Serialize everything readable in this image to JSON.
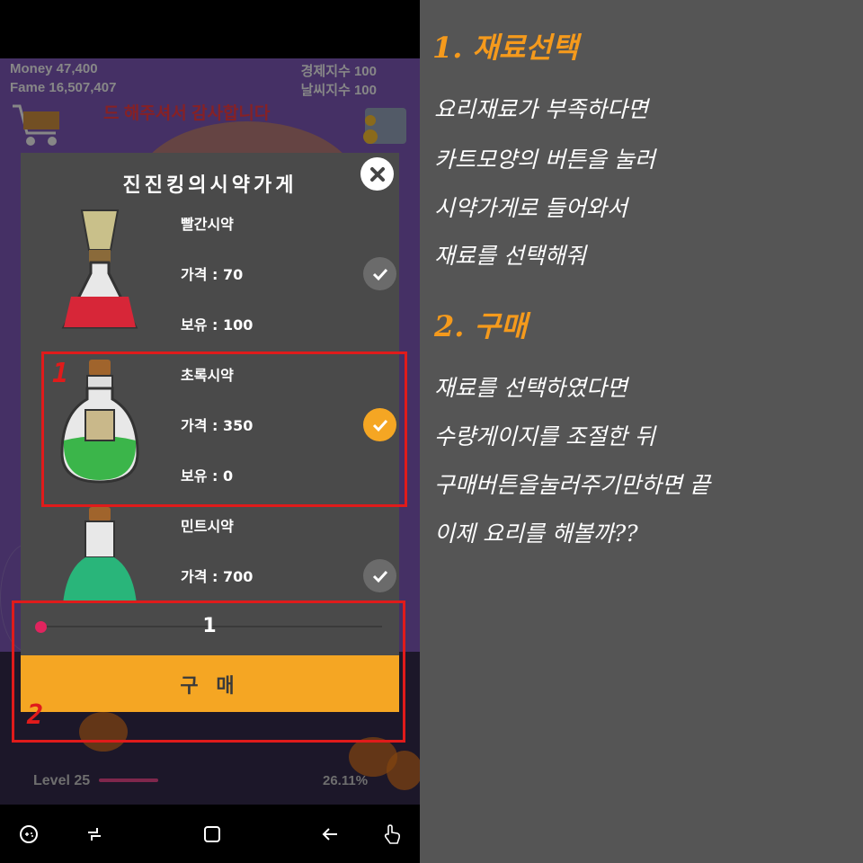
{
  "hud": {
    "money": "Money 47,400",
    "fame": "Fame 16,507,407",
    "economy": "경제지수 100",
    "weather": "날씨지수 100",
    "banner": "드 해주셔서 감사합니다"
  },
  "footer": {
    "level": "Level 25",
    "level_progress": 0.2611,
    "percent": "26.11%"
  },
  "dialog": {
    "title": "진진킹의시약가게",
    "items": [
      {
        "name": "빨간시약",
        "price": "가격 : 70",
        "stock": "보유 : 100",
        "selected": false,
        "color": "#d72638"
      },
      {
        "name": "초록시약",
        "price": "가격 : 350",
        "stock": "보유 : 0",
        "selected": true,
        "color": "#3bb54a"
      },
      {
        "name": "민트시약",
        "price": "가격 : 700",
        "stock": "",
        "selected": false,
        "color": "#29b57a"
      }
    ],
    "quantity": "1",
    "buy_label": "구 매"
  },
  "annotations": {
    "mark1": "1",
    "mark2": "2"
  },
  "notes": {
    "h1": "1. 재료선택",
    "p1": [
      "요리재료가 부족하다면",
      "카트모양의 버튼을 눌러",
      "시약가게로 들어와서",
      "재료를 선택해줘"
    ],
    "h2": "2. 구매",
    "p2": [
      "재료를 선택하였다면",
      "수량게이지를 조절한 뒤",
      "구매버튼을눌러주기만하면 끝",
      "이제 요리를 해볼까??"
    ]
  },
  "colors": {
    "accent": "#f5a623",
    "highlight": "#e01b1b",
    "panel": "#4a4a4a",
    "note_heading": "#f59a1c"
  }
}
